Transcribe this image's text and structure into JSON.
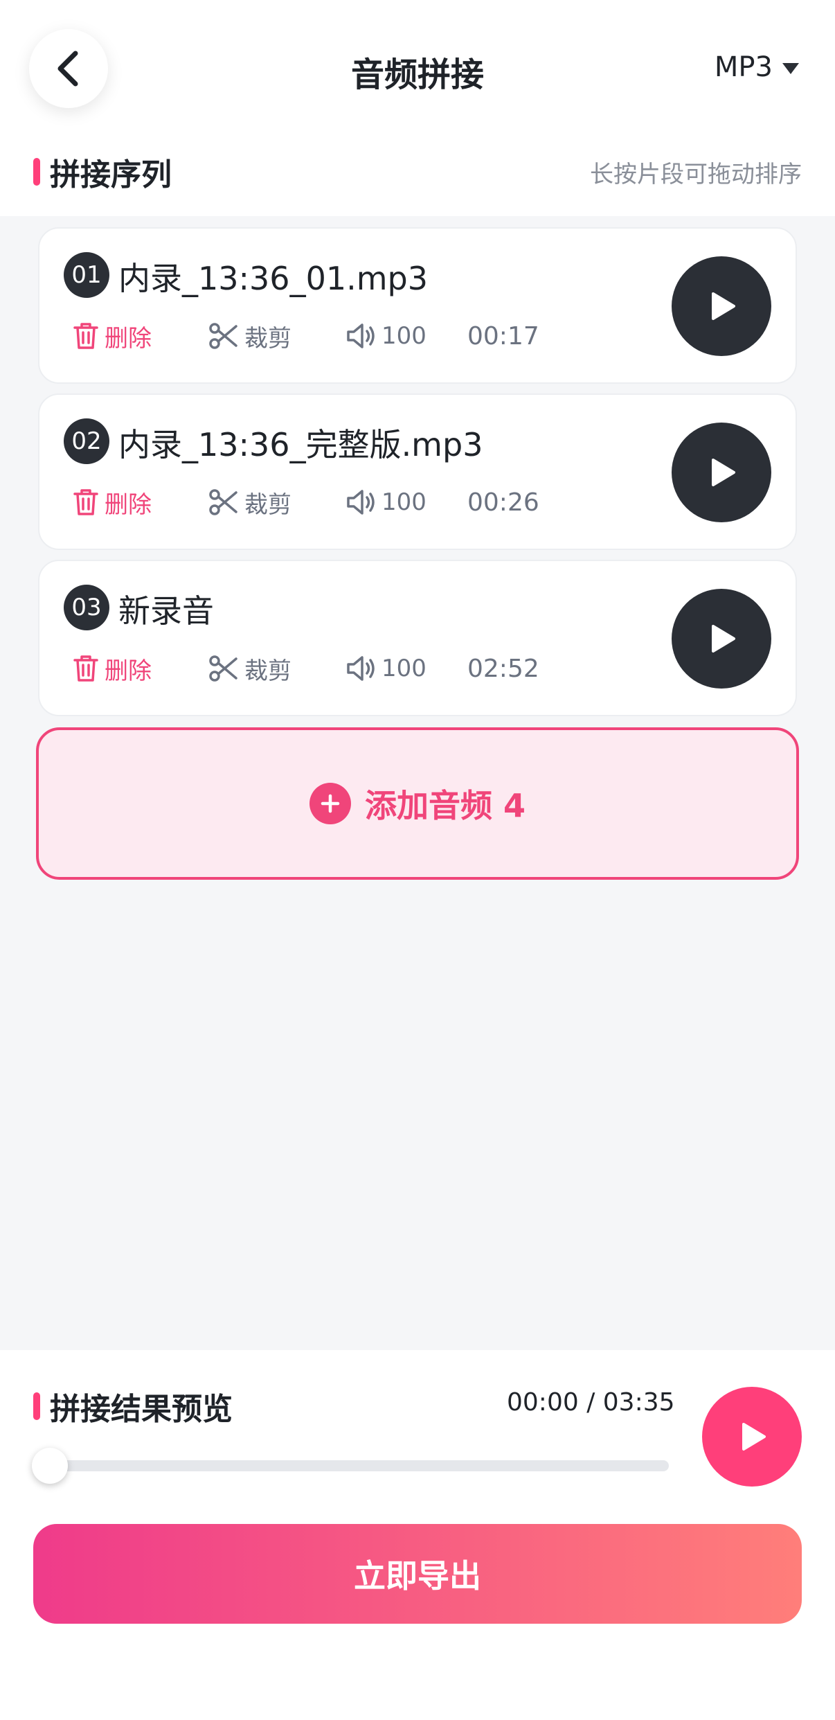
{
  "header": {
    "title": "音频拼接",
    "format": "MP3",
    "back_icon": "chevron-left-icon",
    "dropdown_icon": "caret-down-icon"
  },
  "sequence": {
    "title": "拼接序列",
    "hint": "长按片段可拖动排序",
    "items": [
      {
        "index": "01",
        "name": "内录_13:36_01.mp3",
        "delete_label": "删除",
        "trim_label": "裁剪",
        "volume": "100",
        "duration": "00:17"
      },
      {
        "index": "02",
        "name": "内录_13:36_完整版.mp3",
        "delete_label": "删除",
        "trim_label": "裁剪",
        "volume": "100",
        "duration": "00:26"
      },
      {
        "index": "03",
        "name": "新录音",
        "delete_label": "删除",
        "trim_label": "裁剪",
        "volume": "100",
        "duration": "02:52"
      }
    ],
    "add_label": "添加音频 4"
  },
  "preview": {
    "title": "拼接结果预览",
    "current_time": "00:00",
    "separator": " / ",
    "total_time": "03:35",
    "progress": 0
  },
  "export_label": "立即导出",
  "colors": {
    "accent": "#ff3f7a",
    "dark": "#2b2f36",
    "gradient_start": "#ef3b8a",
    "gradient_end": "#ff7e7a"
  }
}
